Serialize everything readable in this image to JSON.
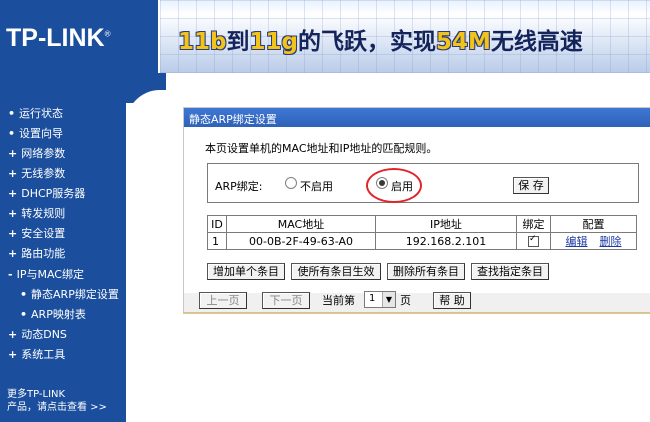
{
  "header": {
    "logo_text": "TP-LINK",
    "logo_mark": "®",
    "banner_part1": "11b",
    "banner_part2": "到",
    "banner_part3": "11g",
    "banner_part4": "的飞跃，实现",
    "banner_part5": "54M",
    "banner_part6": "无线高速"
  },
  "sidebar": {
    "items": [
      {
        "bullet": "•",
        "label": "运行状态"
      },
      {
        "bullet": "•",
        "label": "设置向导"
      },
      {
        "bullet": "+",
        "label": "网络参数"
      },
      {
        "bullet": "+",
        "label": "无线参数"
      },
      {
        "bullet": "+",
        "label": "DHCP服务器"
      },
      {
        "bullet": "+",
        "label": "转发规则"
      },
      {
        "bullet": "+",
        "label": "安全设置"
      },
      {
        "bullet": "+",
        "label": "路由功能"
      },
      {
        "bullet": "-",
        "label": "IP与MAC绑定"
      },
      {
        "bullet": "•",
        "label": "静态ARP绑定设置"
      },
      {
        "bullet": "•",
        "label": "ARP映射表"
      },
      {
        "bullet": "+",
        "label": "动态DNS"
      },
      {
        "bullet": "+",
        "label": "系统工具"
      }
    ],
    "more_line1": "更多TP-LINK",
    "more_line2": "产品，请点击查看 >>"
  },
  "panel": {
    "title": "静态ARP绑定设置",
    "description": "本页设置单机的MAC地址和IP地址的匹配规则。",
    "arp_label": "ARP绑定:",
    "radio_disable": "不启用",
    "radio_enable": "启用",
    "selected": "启用",
    "save_label": "保 存"
  },
  "table": {
    "headers": [
      "ID",
      "MAC地址",
      "IP地址",
      "绑定",
      "配置"
    ],
    "rows": [
      {
        "id": "1",
        "mac": "00-0B-2F-49-63-A0",
        "ip": "192.168.2.101",
        "bound": true,
        "edit": "编辑",
        "delete": "删除"
      }
    ]
  },
  "actions": {
    "add": "增加单个条目",
    "enable_all": "使所有条目生效",
    "delete_all": "删除所有条目",
    "find": "查找指定条目"
  },
  "pager": {
    "prev": "上一页",
    "next": "下一页",
    "current_prefix": "当前第",
    "current_page": "1",
    "suffix": "页",
    "help": "帮 助"
  },
  "colors": {
    "brand_blue": "#1b4f9e",
    "title_bar": "#3e77d4",
    "highlight_circle": "#e0262b"
  }
}
